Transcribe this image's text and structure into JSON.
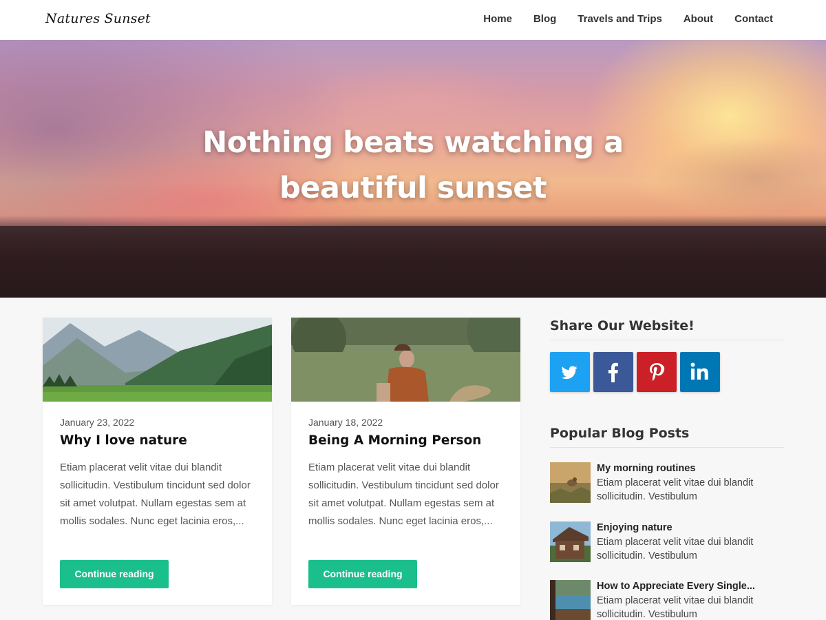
{
  "site": {
    "logo": "Natures Sunset"
  },
  "nav": {
    "items": [
      {
        "label": "Home"
      },
      {
        "label": "Blog"
      },
      {
        "label": "Travels and Trips"
      },
      {
        "label": "About"
      },
      {
        "label": "Contact"
      }
    ]
  },
  "hero": {
    "title": "Nothing beats watching a beautiful sunset"
  },
  "posts": [
    {
      "date": "January 23, 2022",
      "title": "Why I love nature",
      "excerpt": "Etiam placerat velit vitae dui blandit sollicitudin. Vestibulum tincidunt sed dolor sit amet volutpat. Nullam egestas sem at mollis sodales. Nunc eget lacinia eros,...",
      "button": "Continue reading"
    },
    {
      "date": "January 18, 2022",
      "title": "Being A Morning Person",
      "excerpt": "Etiam placerat velit vitae dui blandit sollicitudin. Vestibulum tincidunt sed dolor sit amet volutpat. Nullam egestas sem at mollis sodales. Nunc eget lacinia eros,...",
      "button": "Continue reading"
    }
  ],
  "sidebar": {
    "share_title": "Share Our Website!",
    "share_buttons": [
      {
        "network": "twitter",
        "icon": "twitter-icon",
        "color": "#1da1f2"
      },
      {
        "network": "facebook",
        "icon": "facebook-icon",
        "color": "#3b5998"
      },
      {
        "network": "pinterest",
        "icon": "pinterest-icon",
        "color": "#cb2027"
      },
      {
        "network": "linkedin",
        "icon": "linkedin-icon",
        "color": "#0077b5"
      }
    ],
    "popular_title": "Popular Blog Posts",
    "popular_posts": [
      {
        "title": "My morning routines",
        "excerpt": "Etiam placerat velit vitae dui blandit sollicitudin. Vestibulum"
      },
      {
        "title": "Enjoying nature",
        "excerpt": "Etiam placerat velit vitae dui blandit sollicitudin. Vestibulum"
      },
      {
        "title": "How to Appreciate Every Single...",
        "excerpt": "Etiam placerat velit vitae dui blandit sollicitudin. Vestibulum"
      }
    ]
  },
  "colors": {
    "accent": "#1bbf8b",
    "background": "#f7f7f7"
  }
}
